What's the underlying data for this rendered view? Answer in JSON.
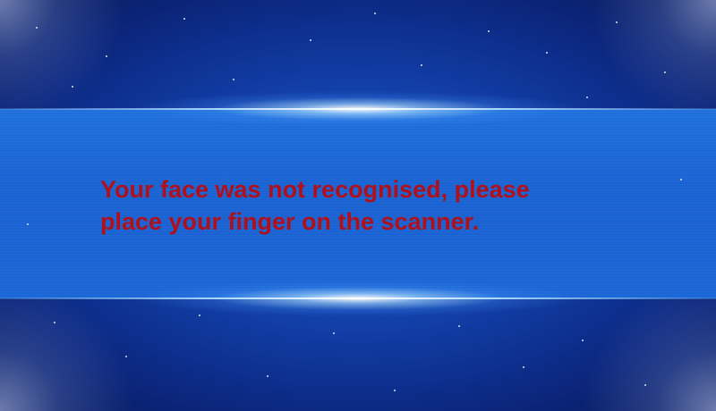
{
  "message": {
    "text": "Your face was not recognised, please\nplace your finger on the scanner.",
    "color": "#b0101a"
  },
  "colors": {
    "background": "#0c2a85",
    "band": "#1a63d3"
  }
}
